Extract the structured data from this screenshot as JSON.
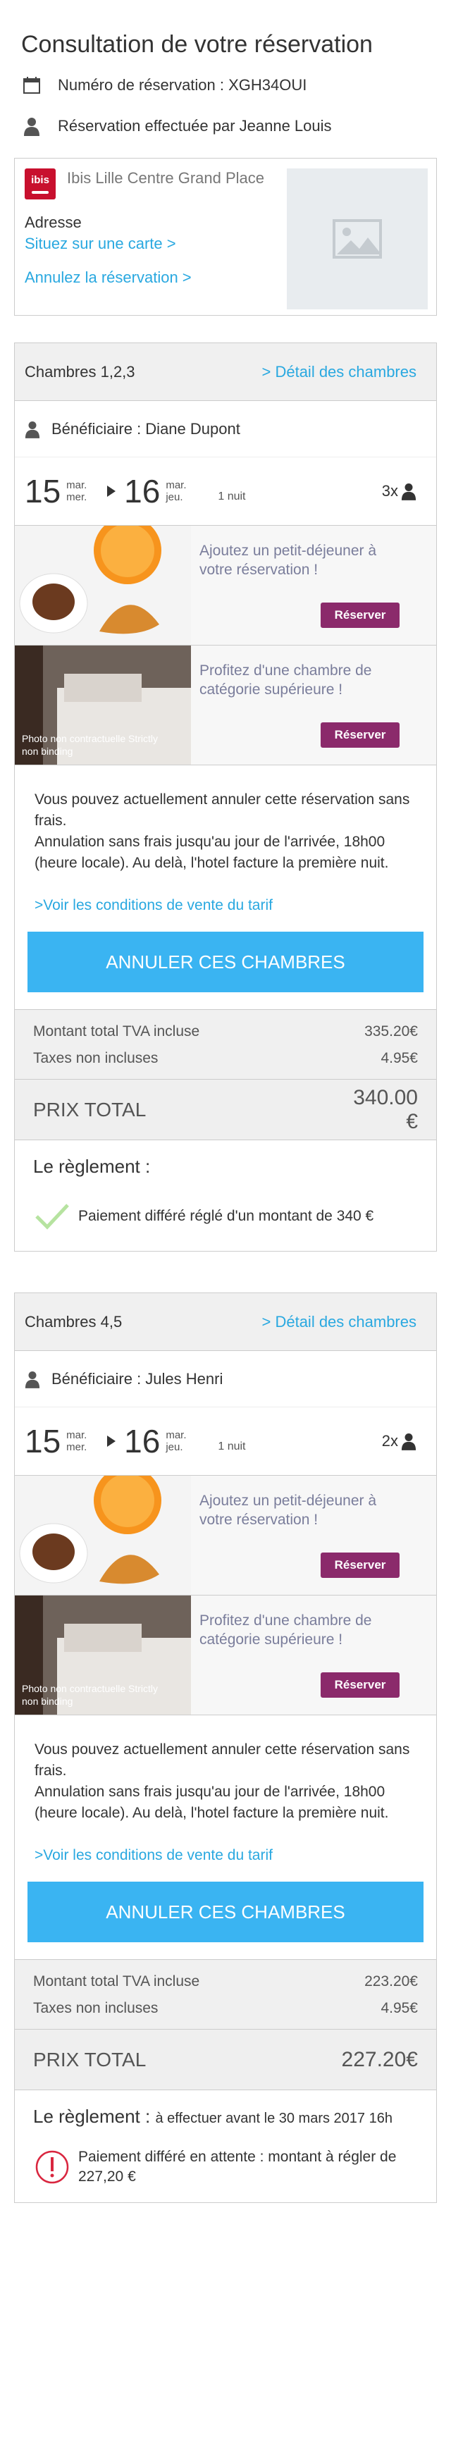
{
  "page_title": "Consultation de votre réservation",
  "booking_number": "Numéro de réservation : XGH34OUI",
  "booked_by": "Réservation effectuée par Jeanne Louis",
  "hotel": {
    "logo_text": "ibis",
    "name": "Ibis Lille Centre Grand Place",
    "address_label": "Adresse",
    "map_link": "Situez sur une carte >",
    "cancel_link": "Annulez la réservation >"
  },
  "colors": {
    "accent": "#29a8e0",
    "button": "#3ab4f2",
    "brand_red": "#c8102e",
    "promo_button": "#8b2a6b"
  },
  "rooms": [
    {
      "title": "Chambres 1,2,3",
      "details_link": "> Détail des chambres",
      "beneficiary": "Bénéficiaire : Diane Dupont",
      "checkin_day": "15",
      "checkin_weekday": "mar. mer.",
      "checkout_day": "16",
      "checkout_weekday": "mar. jeu.",
      "nights": "1 nuit",
      "guests": "3x",
      "promo_breakfast": "Ajoutez un petit-déjeuner à votre réservation !",
      "promo_breakfast_btn": "Réserver",
      "promo_upgrade": "Profitez d'une chambre de catégorie supérieure !",
      "promo_upgrade_btn": "Réserver",
      "photo_credit": "Photo non contractuelle Strictly non binding",
      "cancel_text_1": "Vous pouvez actuellement annuler cette réservation sans frais.",
      "cancel_text_2": "Annulation sans frais jusqu'au jour de l'arrivée, 18h00 (heure locale). Au delà, l'hotel facture la première nuit.",
      "conditions_link": ">Voir les conditions de vente du tarif",
      "cancel_button": "ANNULER CES CHAMBRES",
      "total_label": "Montant total TVA incluse",
      "total_value": "335.20€",
      "taxes_label": "Taxes non incluses",
      "taxes_value": "4.95€",
      "grand_label": "PRIX TOTAL",
      "grand_value": "340.00 €",
      "payment_title": "Le règlement :",
      "payment_subtitle": "",
      "payment_status": "Paiement différé réglé d'un montant de 340 €",
      "payment_icon": "check-icon"
    },
    {
      "title": "Chambres 4,5",
      "details_link": "> Détail des chambres",
      "beneficiary": "Bénéficiaire : Jules Henri",
      "checkin_day": "15",
      "checkin_weekday": "mar. mer.",
      "checkout_day": "16",
      "checkout_weekday": "mar. jeu.",
      "nights": "1 nuit",
      "guests": "2x",
      "promo_breakfast": "Ajoutez un petit-déjeuner à votre réservation !",
      "promo_breakfast_btn": "Réserver",
      "promo_upgrade": "Profitez d'une chambre de catégorie supérieure !",
      "promo_upgrade_btn": "Réserver",
      "photo_credit": "Photo non contractuelle Strictly non binding",
      "cancel_text_1": "Vous pouvez actuellement annuler cette réservation sans frais.",
      "cancel_text_2": "Annulation sans frais jusqu'au jour de l'arrivée, 18h00 (heure locale). Au delà, l'hotel facture la première nuit.",
      "conditions_link": ">Voir les conditions de vente du tarif",
      "cancel_button": "ANNULER CES CHAMBRES",
      "total_label": "Montant total TVA incluse",
      "total_value": "223.20€",
      "taxes_label": "Taxes non incluses",
      "taxes_value": "4.95€",
      "grand_label": "PRIX TOTAL",
      "grand_value": "227.20€",
      "payment_title": "Le règlement :",
      "payment_subtitle": "à effectuer avant le 30 mars 2017 16h",
      "payment_status": "Paiement différé en attente : montant à régler de 227,20 €",
      "payment_icon": "warning-icon"
    }
  ]
}
